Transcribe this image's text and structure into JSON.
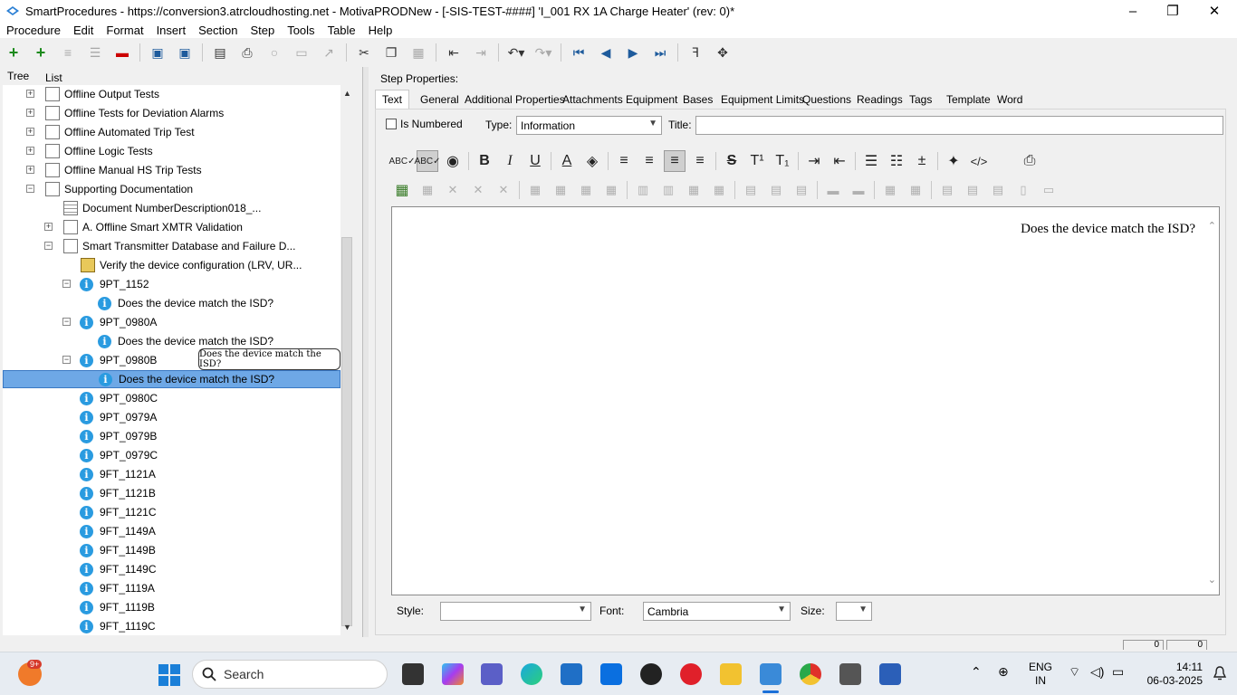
{
  "window": {
    "title": "SmartProcedures - https://conversion3.atrcloudhosting.net - MotivaPRODNew - [-SIS-TEST-####] 'I_001 RX 1A Charge Heater' (rev: 0)*",
    "minimize": "–",
    "restore": "❐",
    "close": "✕"
  },
  "menu": [
    "Procedure",
    "Edit",
    "Format",
    "Insert",
    "Section",
    "Step",
    "Tools",
    "Table",
    "Help"
  ],
  "left_tabs": {
    "tree": "Tree",
    "list": "List"
  },
  "tree": [
    {
      "label": "Offline Output Tests",
      "level": 1,
      "icon": "document-stack-icon",
      "expander": "+"
    },
    {
      "label": "Offline Tests for Deviation Alarms",
      "level": 1,
      "icon": "document-stack-icon",
      "expander": "+"
    },
    {
      "label": "Offline Automated Trip Test",
      "level": 1,
      "icon": "document-stack-icon",
      "expander": "+"
    },
    {
      "label": "Offline Logic Tests",
      "level": 1,
      "icon": "document-stack-icon",
      "expander": "+"
    },
    {
      "label": "Offline Manual HS Trip Tests",
      "level": 1,
      "icon": "document-stack-icon",
      "expander": "+"
    },
    {
      "label": "Supporting Documentation",
      "level": 1,
      "icon": "document-stack-icon",
      "expander": "−"
    },
    {
      "label": "Document NumberDescription018_...",
      "level": 2,
      "icon": "table-icon",
      "expander": ""
    },
    {
      "label": "A. Offline Smart XMTR Validation",
      "level": 2,
      "icon": "document-stack-icon",
      "expander": "+"
    },
    {
      "label": "Smart Transmitter Database and Failure D...",
      "level": 2,
      "icon": "document-stack-icon",
      "expander": "−"
    },
    {
      "label": "Verify the device configuration (LRV, UR...",
      "level": 3,
      "icon": "procedure-step-icon",
      "expander": ""
    },
    {
      "label": "9PT_1152",
      "level": 3,
      "icon": "info-icon",
      "expander": "−"
    },
    {
      "label": "Does the device match the ISD?",
      "level": 4,
      "icon": "info-icon",
      "expander": ""
    },
    {
      "label": "9PT_0980A",
      "level": 3,
      "icon": "info-icon",
      "expander": "−"
    },
    {
      "label": "Does the device match the ISD?",
      "level": 4,
      "icon": "info-icon",
      "expander": ""
    },
    {
      "label": "9PT_0980B",
      "level": 3,
      "icon": "info-icon",
      "expander": "−"
    },
    {
      "label": "Does the device match the ISD?",
      "level": 4,
      "icon": "info-icon",
      "expander": "",
      "selected": true
    },
    {
      "label": "9PT_0980C",
      "level": 3,
      "icon": "info-icon",
      "expander": ""
    },
    {
      "label": "9PT_0979A",
      "level": 3,
      "icon": "info-icon",
      "expander": ""
    },
    {
      "label": "9PT_0979B",
      "level": 3,
      "icon": "info-icon",
      "expander": ""
    },
    {
      "label": "9PT_0979C",
      "level": 3,
      "icon": "info-icon",
      "expander": ""
    },
    {
      "label": "9FT_1121A",
      "level": 3,
      "icon": "info-icon",
      "expander": ""
    },
    {
      "label": "9FT_1121B",
      "level": 3,
      "icon": "info-icon",
      "expander": ""
    },
    {
      "label": "9FT_1121C",
      "level": 3,
      "icon": "info-icon",
      "expander": ""
    },
    {
      "label": "9FT_1149A",
      "level": 3,
      "icon": "info-icon",
      "expander": ""
    },
    {
      "label": "9FT_1149B",
      "level": 3,
      "icon": "info-icon",
      "expander": ""
    },
    {
      "label": "9FT_1149C",
      "level": 3,
      "icon": "info-icon",
      "expander": ""
    },
    {
      "label": "9FT_1119A",
      "level": 3,
      "icon": "info-icon",
      "expander": ""
    },
    {
      "label": "9FT_1119B",
      "level": 3,
      "icon": "info-icon",
      "expander": ""
    },
    {
      "label": "9FT_1119C",
      "level": 3,
      "icon": "info-icon",
      "expander": ""
    }
  ],
  "tooltip": "Does the device match the ISD?",
  "step_properties": {
    "heading": "Step Properties:",
    "tabs": [
      "Text",
      "General",
      "Additional Properties",
      "Attachments",
      "Equipment",
      "Bases",
      "Equipment Limits",
      "Questions",
      "Readings",
      "Tags",
      "Template",
      "Word"
    ],
    "active_tab": "Text",
    "is_numbered_label": "Is Numbered",
    "type_label": "Type:",
    "type_value": "Information",
    "title_label": "Title:",
    "title_value": "",
    "editor_text": "Does the device match the ISD?",
    "style_label": "Style:",
    "style_value": "",
    "font_label": "Font:",
    "font_value": "Cambria",
    "size_label": "Size:",
    "size_value": ""
  },
  "status": {
    "box1": "0",
    "box2": "0"
  },
  "taskbar": {
    "search_label": "Search",
    "notification_badge": "9+",
    "language": "ENG",
    "region": "IN",
    "time": "14:11",
    "date": "06-03-2025"
  },
  "colors": {
    "selection": "#6ea8e6",
    "info_icon": "#2a9be0",
    "accent": "#1e5b9c"
  }
}
